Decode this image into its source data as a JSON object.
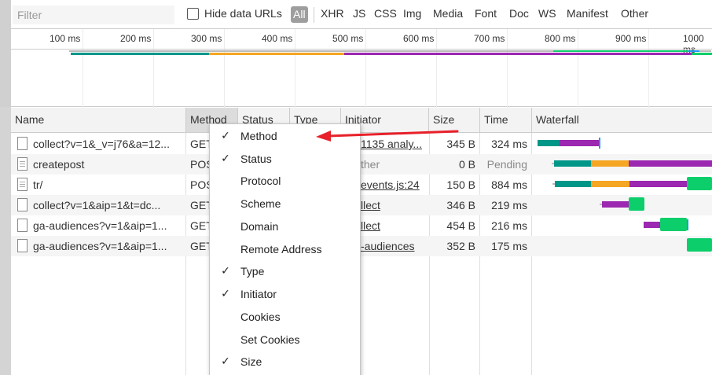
{
  "filter": {
    "placeholder": "Filter",
    "value": ""
  },
  "hide_data_urls": {
    "label": "Hide data URLs",
    "checked": false
  },
  "type_filters": [
    "All",
    "XHR",
    "JS",
    "CSS",
    "Img",
    "Media",
    "Font",
    "Doc",
    "WS",
    "Manifest",
    "Other"
  ],
  "active_type": "All",
  "overview": {
    "ticks": [
      "100 ms",
      "200 ms",
      "300 ms",
      "400 ms",
      "500 ms",
      "600 ms",
      "700 ms",
      "800 ms",
      "900 ms",
      "1000 ms"
    ]
  },
  "columns": {
    "name": "Name",
    "method": "Method",
    "status": "Status",
    "type": "Type",
    "initiator": "Initiator",
    "size": "Size",
    "time": "Time",
    "waterfall": "Waterfall"
  },
  "rows": [
    {
      "name": "collect?v=1&_v=j76&a=12...",
      "method": "GET",
      "initiator": "1135 analy...",
      "size": "345 B",
      "time": "324 ms"
    },
    {
      "name": "createpost",
      "method": "POS",
      "initiator": "ther",
      "size": "0 B",
      "time": "Pending"
    },
    {
      "name": "tr/",
      "method": "POS",
      "initiator": "events.js:24",
      "size": "150 B",
      "time": "884 ms"
    },
    {
      "name": "collect?v=1&aip=1&t=dc...",
      "method": "GET",
      "initiator": "llect",
      "size": "346 B",
      "time": "219 ms"
    },
    {
      "name": "ga-audiences?v=1&aip=1...",
      "method": "GET",
      "initiator": "llect",
      "size": "454 B",
      "time": "216 ms"
    },
    {
      "name": "ga-audiences?v=1&aip=1...",
      "method": "GET",
      "initiator": "-audiences",
      "size": "352 B",
      "time": "175 ms"
    }
  ],
  "context_menu": [
    {
      "label": "Method",
      "checked": true
    },
    {
      "label": "Status",
      "checked": true
    },
    {
      "label": "Protocol",
      "checked": false
    },
    {
      "label": "Scheme",
      "checked": false
    },
    {
      "label": "Domain",
      "checked": false
    },
    {
      "label": "Remote Address",
      "checked": false
    },
    {
      "label": "Type",
      "checked": true
    },
    {
      "label": "Initiator",
      "checked": true
    },
    {
      "label": "Cookies",
      "checked": false
    },
    {
      "label": "Set Cookies",
      "checked": false
    },
    {
      "label": "Size",
      "checked": true
    }
  ],
  "check_glyph": "✓",
  "colors": {
    "waiting": "#009688",
    "queue": "#f5a623",
    "download": "#9c27b0",
    "receive": "#0cce6b",
    "annotation": "#e8202a"
  }
}
